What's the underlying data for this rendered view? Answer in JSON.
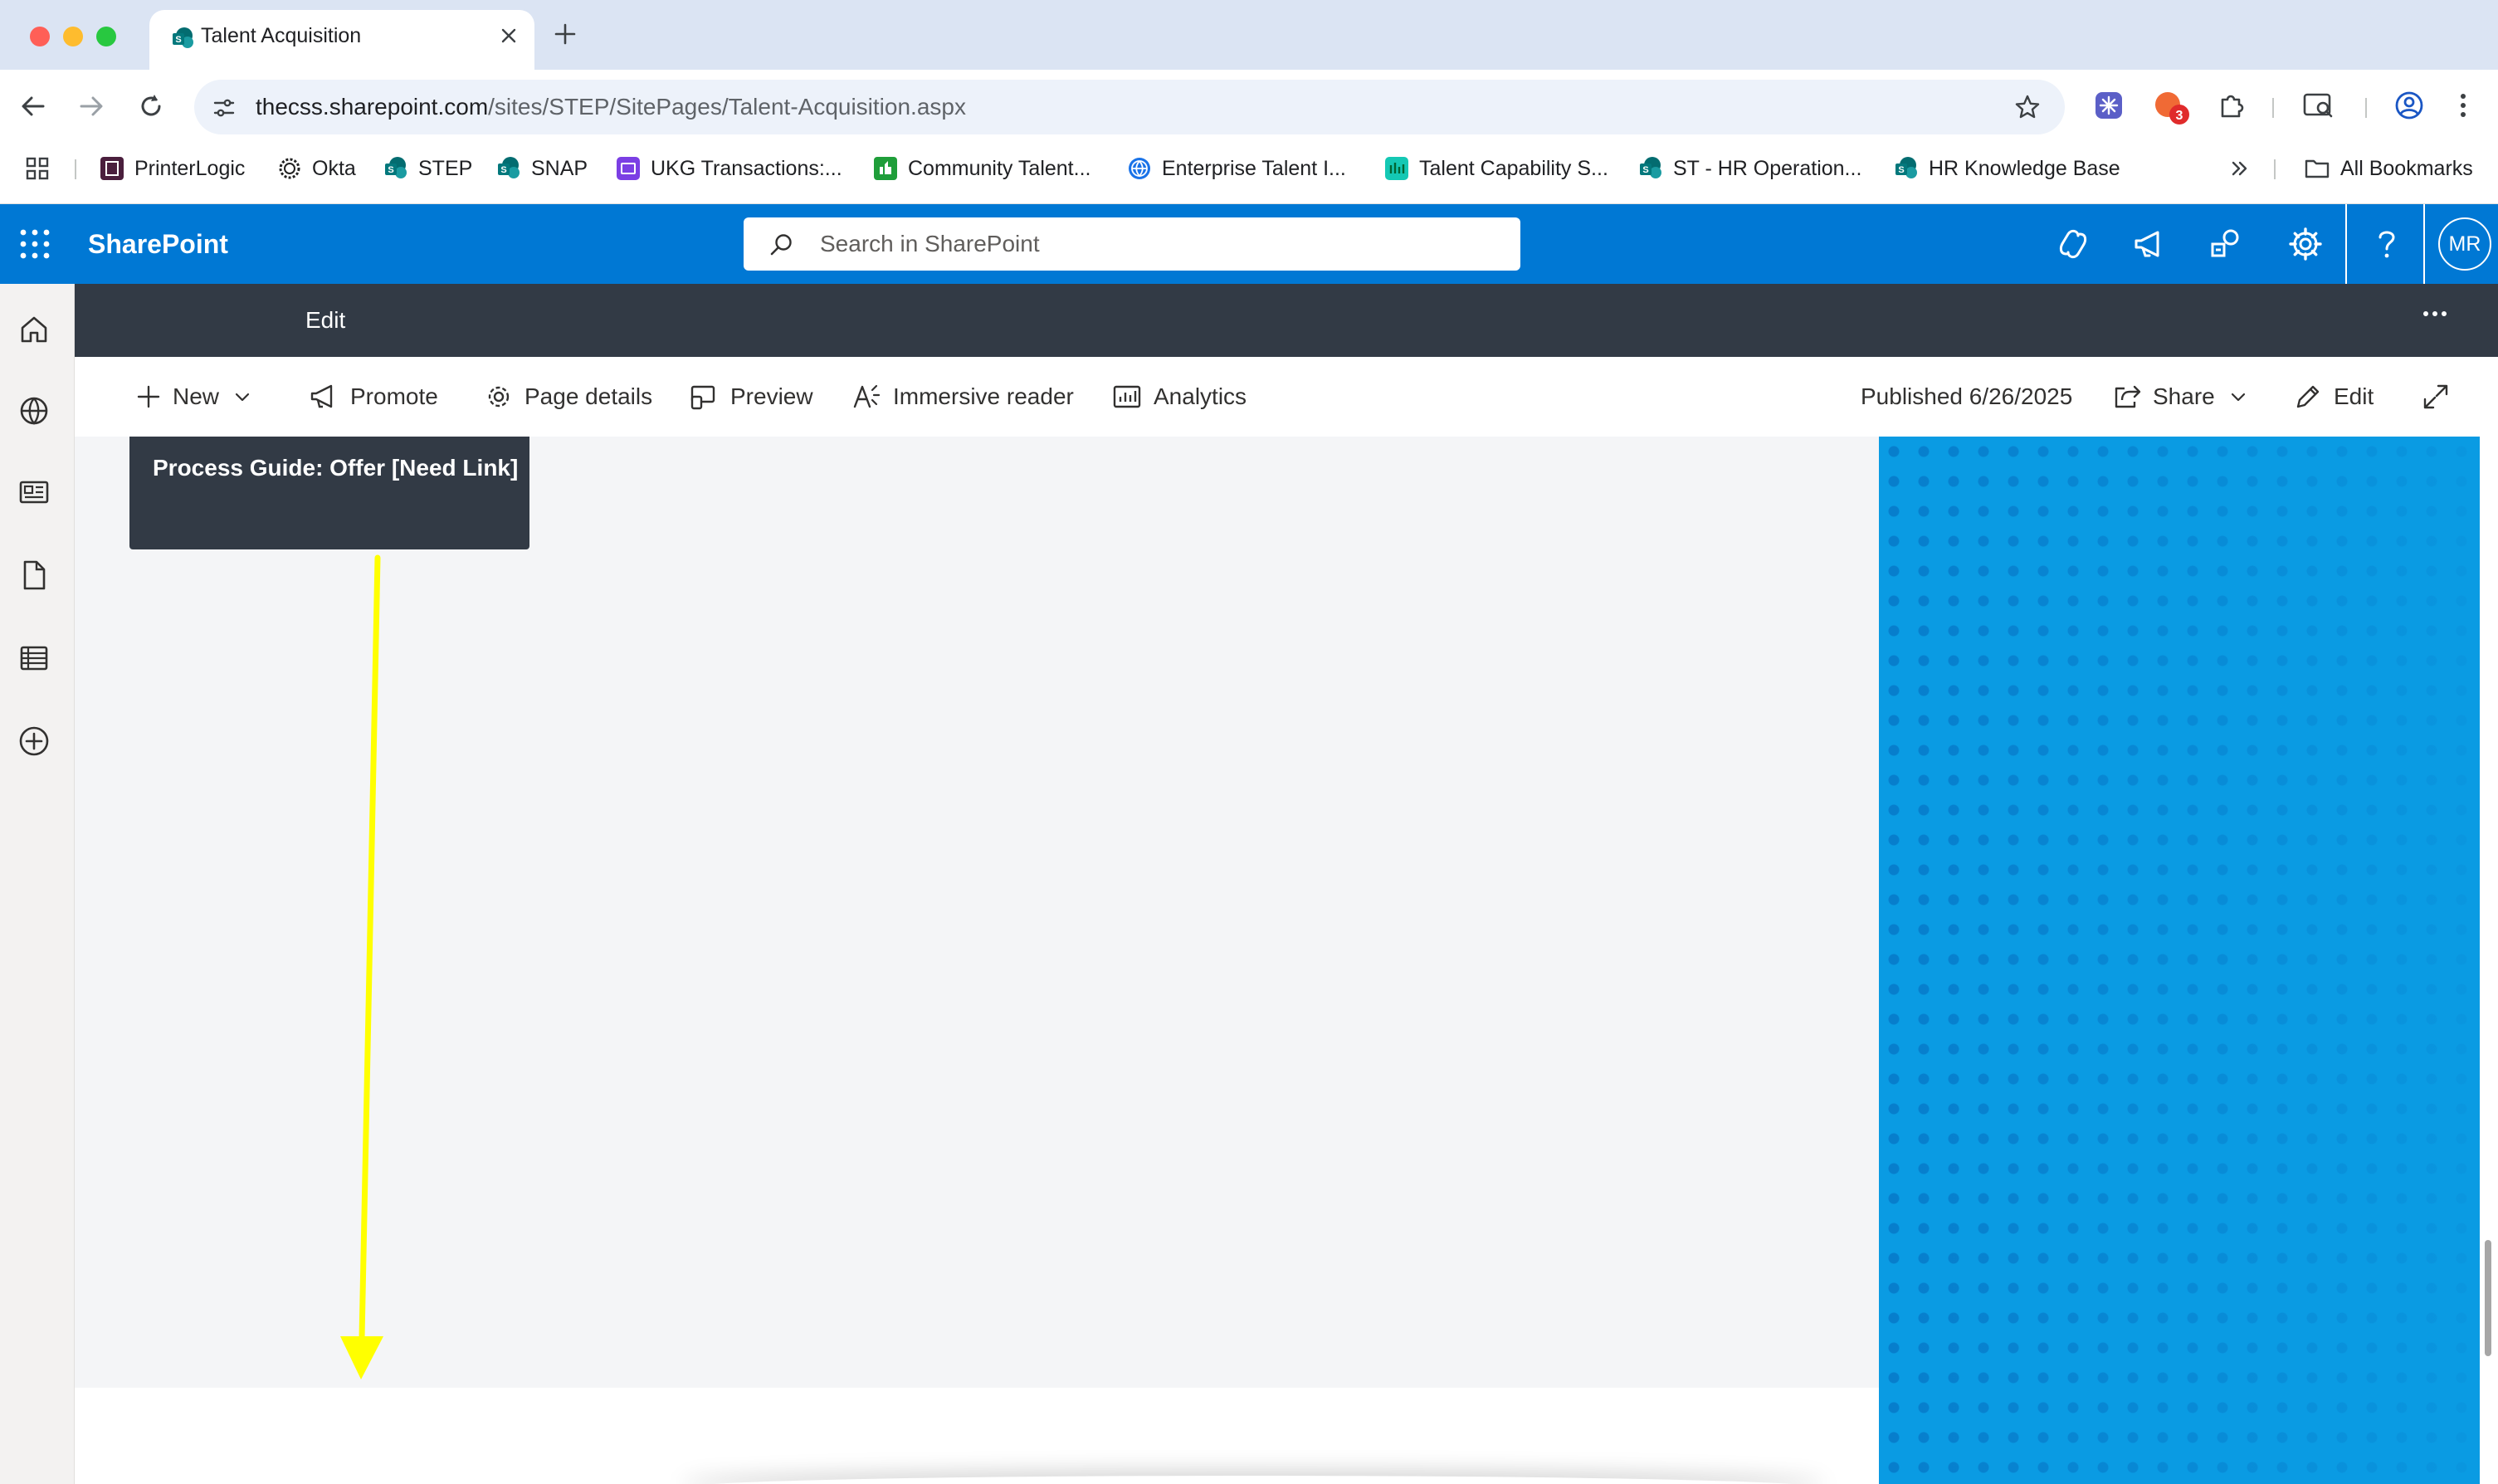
{
  "browser": {
    "tab_title": "Talent Acquisition",
    "url_host": "thecss.sharepoint.com",
    "url_path": "/sites/STEP/SitePages/Talent-Acquisition.aspx",
    "extension_badge": "3",
    "bookmarks": [
      {
        "label": "PrinterLogic",
        "icon": "printerlogic-icon"
      },
      {
        "label": "Okta",
        "icon": "okta-icon"
      },
      {
        "label": "STEP",
        "icon": "sharepoint-icon"
      },
      {
        "label": "SNAP",
        "icon": "sharepoint-icon"
      },
      {
        "label": "UKG Transactions:...",
        "icon": "ukg-icon"
      },
      {
        "label": "Community Talent...",
        "icon": "community-icon"
      },
      {
        "label": "Enterprise Talent I...",
        "icon": "globe-icon"
      },
      {
        "label": "Talent Capability S...",
        "icon": "capability-icon"
      },
      {
        "label": "ST - HR Operation...",
        "icon": "sharepoint-icon"
      },
      {
        "label": "HR Knowledge Base",
        "icon": "sharepoint-icon"
      }
    ],
    "all_bookmarks": "All Bookmarks"
  },
  "suite": {
    "brand": "SharePoint",
    "search_placeholder": "Search in SharePoint",
    "avatar_initials": "MR"
  },
  "edit_band": {
    "label": "Edit"
  },
  "commands": {
    "new": "New",
    "promote": "Promote",
    "page_details": "Page details",
    "preview": "Preview",
    "immersive_reader": "Immersive reader",
    "analytics": "Analytics",
    "published": "Published 6/26/2025",
    "share": "Share",
    "edit": "Edit"
  },
  "content": {
    "card_title": "Process Guide: Offer [Need Link]"
  },
  "colors": {
    "suite_blue": "#0078d4",
    "edit_band": "#323a45",
    "hero_blue": "#0a9be3",
    "annotation_arrow": "#ffff00"
  }
}
